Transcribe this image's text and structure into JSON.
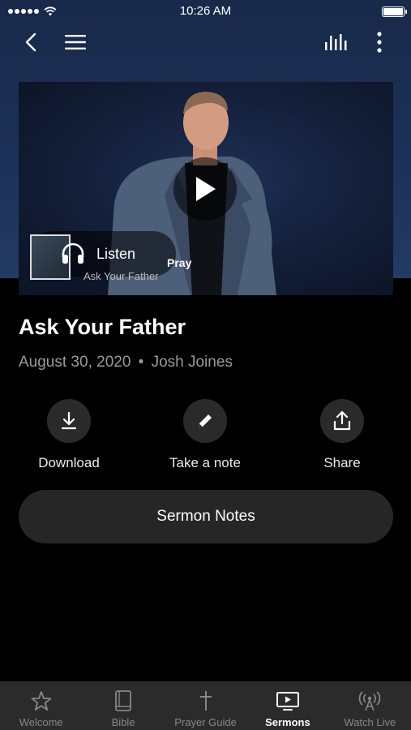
{
  "status": {
    "time": "10:26 AM"
  },
  "nav": {
    "back_icon": "chevron-left-icon",
    "menu_icon": "hamburger-menu-icon",
    "audio_icon": "audio-levels-icon",
    "more_icon": "more-vertical-icon"
  },
  "video": {
    "listen_label": "Listen",
    "overlay_title": "Pray",
    "overlay_subtitle": "Ask Your Father"
  },
  "sermon": {
    "title": "Ask Your Father",
    "date": "August 30, 2020",
    "separator": "•",
    "speaker": "Josh Joines"
  },
  "actions": [
    {
      "label": "Download",
      "icon": "download-icon"
    },
    {
      "label": "Take a note",
      "icon": "pencil-icon"
    },
    {
      "label": "Share",
      "icon": "share-icon"
    }
  ],
  "notes_button": {
    "label": "Sermon Notes"
  },
  "tabs": [
    {
      "label": "Welcome",
      "icon": "star-icon",
      "active": false
    },
    {
      "label": "Bible",
      "icon": "book-icon",
      "active": false
    },
    {
      "label": "Prayer Guide",
      "icon": "cross-icon",
      "active": false
    },
    {
      "label": "Sermons",
      "icon": "tv-play-icon",
      "active": true
    },
    {
      "label": "Watch Live",
      "icon": "broadcast-icon",
      "active": false
    }
  ],
  "colors": {
    "header_gradient_top": "#18294a",
    "header_gradient_bottom": "#233a63",
    "background": "#000000",
    "secondary_text": "#9a9a9a",
    "tab_bar": "#2b2b2b"
  }
}
